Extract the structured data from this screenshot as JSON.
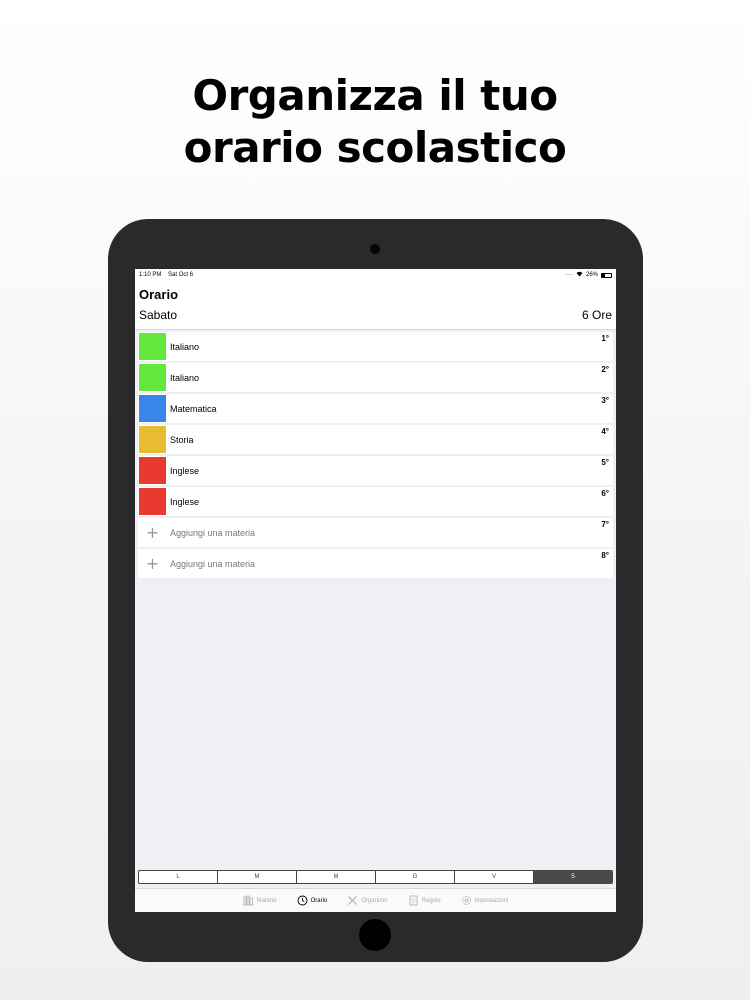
{
  "headline": {
    "line1": "Organizza il tuo",
    "line2": "orario scolastico"
  },
  "statusbar": {
    "time": "1:10 PM",
    "date": "Sat Oct 6",
    "battery": "26%"
  },
  "nav": {
    "title": "Orario",
    "day": "Sabato",
    "hours": "6 Ore"
  },
  "rows": [
    {
      "label": "Italiano",
      "num": "1°",
      "color": "#62e83a"
    },
    {
      "label": "Italiano",
      "num": "2°",
      "color": "#62e83a"
    },
    {
      "label": "Matematica",
      "num": "3°",
      "color": "#3a86e8"
    },
    {
      "label": "Storia",
      "num": "4°",
      "color": "#e8bc30"
    },
    {
      "label": "Inglese",
      "num": "5°",
      "color": "#e83a30"
    },
    {
      "label": "Inglese",
      "num": "6°",
      "color": "#e83a30"
    },
    {
      "label": "Aggiungi una materia",
      "num": "7°"
    },
    {
      "label": "Aggiungi una materia",
      "num": "8°"
    }
  ],
  "days": [
    "L",
    "M",
    "M",
    "G",
    "V",
    "S"
  ],
  "tabs": [
    {
      "label": "Materie",
      "icon": "books-icon"
    },
    {
      "label": "Orario",
      "icon": "clock-icon"
    },
    {
      "label": "Organizer",
      "icon": "tools-icon"
    },
    {
      "label": "Regole",
      "icon": "document-icon"
    },
    {
      "label": "Impostazioni",
      "icon": "gear-icon"
    }
  ]
}
